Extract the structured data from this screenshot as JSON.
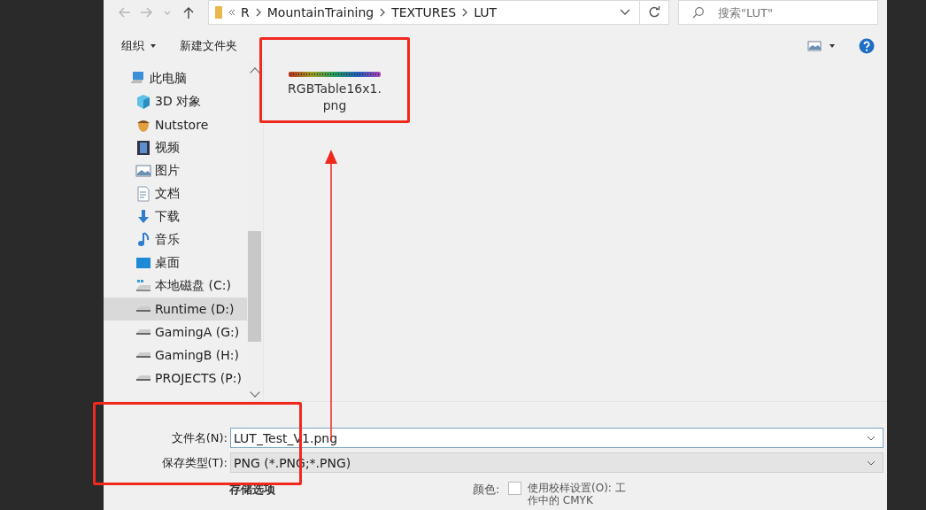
{
  "toolbar": {
    "nav": [
      {
        "kind": "back",
        "disabled": true
      },
      {
        "kind": "forward",
        "disabled": true
      },
      {
        "kind": "recent",
        "disabled": true
      },
      {
        "kind": "up",
        "disabled": false
      }
    ],
    "path": [
      "R",
      "MountainTraining",
      "TEXTURES",
      "LUT"
    ],
    "search": {
      "placeholder": "搜索\"LUT\""
    },
    "organize": "组织",
    "new_folder": "新建文件夹"
  },
  "sidebar": {
    "items": [
      {
        "label": "此电脑",
        "kind": "pc",
        "selected": false
      },
      {
        "label": "3D 对象",
        "kind": "cube",
        "selected": false
      },
      {
        "label": "Nutstore",
        "kind": "nut",
        "selected": false
      },
      {
        "label": "视频",
        "kind": "video",
        "selected": false
      },
      {
        "label": "图片",
        "kind": "image",
        "selected": false
      },
      {
        "label": "文档",
        "kind": "doc",
        "selected": false
      },
      {
        "label": "下载",
        "kind": "download",
        "selected": false
      },
      {
        "label": "音乐",
        "kind": "music",
        "selected": false
      },
      {
        "label": "桌面",
        "kind": "desktop",
        "selected": false
      },
      {
        "label": "本地磁盘 (C:)",
        "kind": "sysdrive",
        "selected": false
      },
      {
        "label": "Runtime (D:)",
        "kind": "drive",
        "selected": true
      },
      {
        "label": "GamingA (G:)",
        "kind": "drive",
        "selected": false
      },
      {
        "label": "GamingB (H:)",
        "kind": "drive",
        "selected": false
      },
      {
        "label": "PROJECTS (P:)",
        "kind": "drive",
        "selected": false
      }
    ]
  },
  "files": [
    {
      "name": "RGBTable16x1.\npng",
      "highlighted": true
    }
  ],
  "save_form": {
    "highlighted": true,
    "file_name": {
      "label": "文件名(N):",
      "value": "LUT_Test_V1.png"
    },
    "file_type": {
      "label": "保存类型(T):",
      "value": "PNG (*.PNG;*.PNG)"
    }
  },
  "options": {
    "title": "存储选项",
    "color_label": "颜色:",
    "proof": {
      "label": "使用校样设置(O): 工",
      "detail": "作中的 CMYK",
      "checked": false
    }
  },
  "annotation_arrow": true
}
